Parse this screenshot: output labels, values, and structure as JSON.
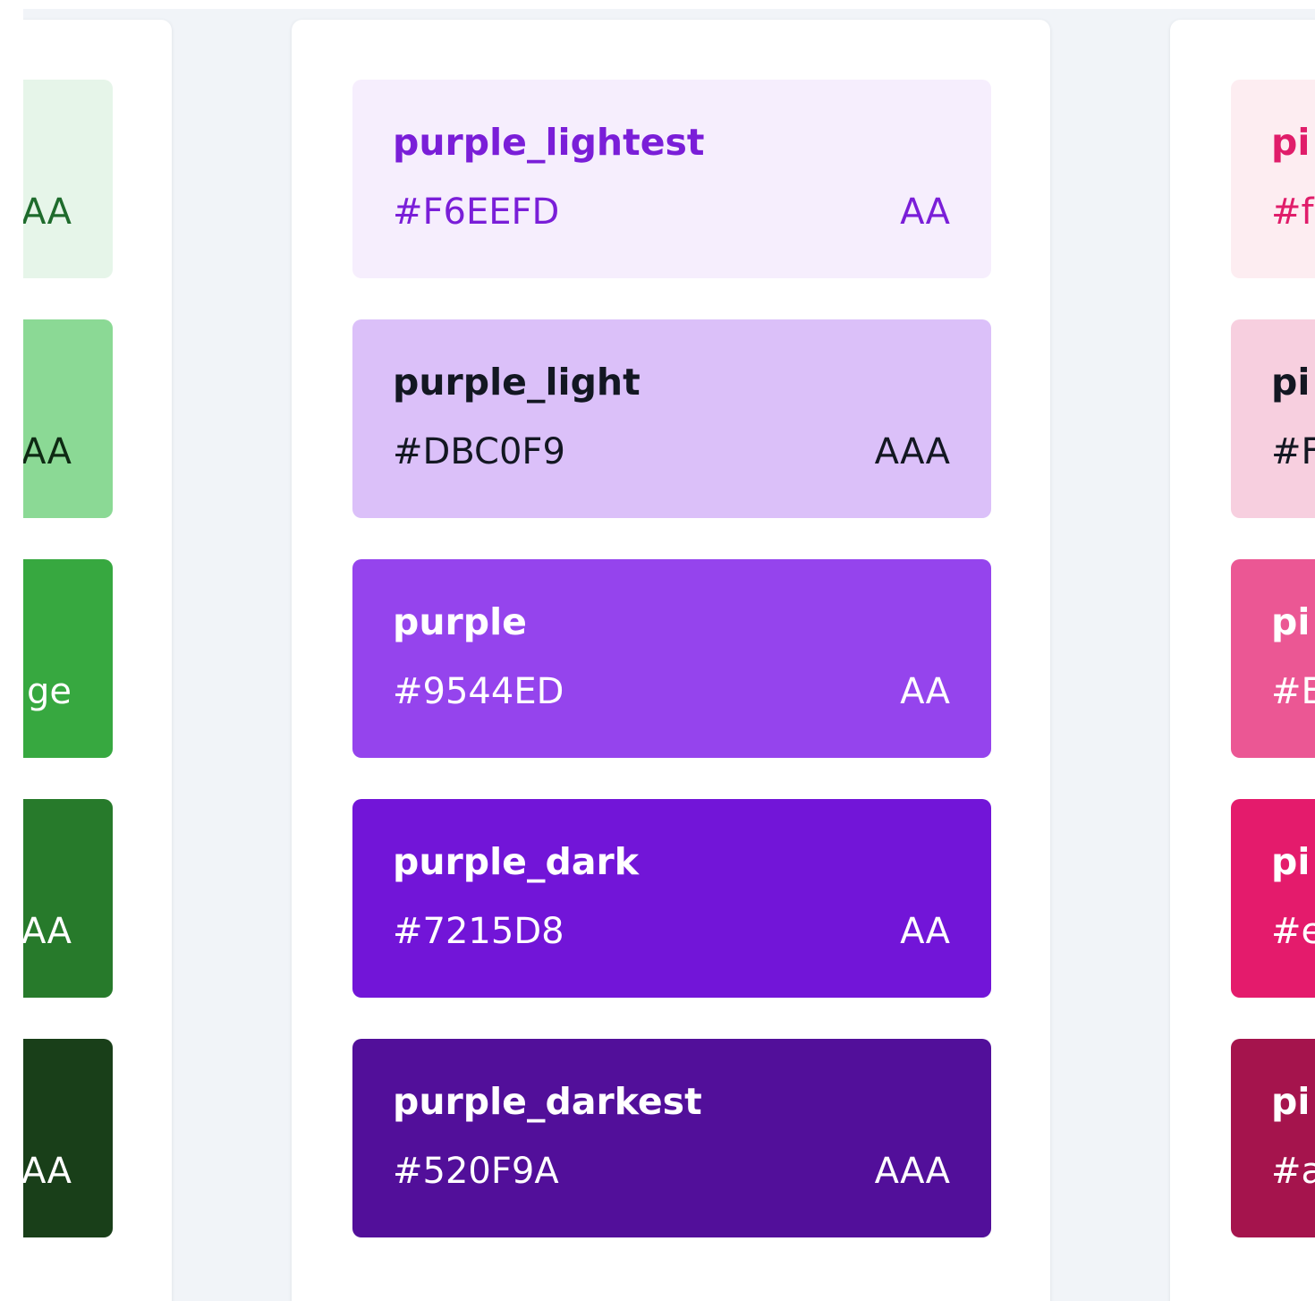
{
  "green_column": {
    "swatches": [
      {
        "hex": "",
        "grade": "AA",
        "bg": "#e6f5e9",
        "fg": "#1e6b2c"
      },
      {
        "hex": "",
        "grade": "AA",
        "bg": "#8bd995",
        "fg": "#0e2a13"
      },
      {
        "hex": "",
        "grade": "ge",
        "bg": "#37a840",
        "fg": "#ffffff"
      },
      {
        "hex": "",
        "grade": "AA",
        "bg": "#277a2b",
        "fg": "#ffffff"
      },
      {
        "hex": "",
        "grade": "AA",
        "bg": "#193f19",
        "fg": "#ffffff"
      }
    ]
  },
  "purple_column": {
    "swatches": [
      {
        "name": "purple_lightest",
        "hex": "#F6EEFD",
        "grade": "AA",
        "bg": "#f6eefd",
        "fg": "#7a1ed8"
      },
      {
        "name": "purple_light",
        "hex": "#DBC0F9",
        "grade": "AAA",
        "bg": "#dbc0f9",
        "fg": "#131722"
      },
      {
        "name": "purple",
        "hex": "#9544ED",
        "grade": "AA",
        "bg": "#9544ed",
        "fg": "#ffffff"
      },
      {
        "name": "purple_dark",
        "hex": "#7215D8",
        "grade": "AA",
        "bg": "#7215d8",
        "fg": "#ffffff"
      },
      {
        "name": "purple_darkest",
        "hex": "#520F9A",
        "grade": "AAA",
        "bg": "#520f9a",
        "fg": "#ffffff"
      }
    ]
  },
  "pink_column": {
    "swatches": [
      {
        "name": "pi",
        "hex": "#f",
        "bg": "#fdedf1",
        "fg": "#e01d6a"
      },
      {
        "name": "pi",
        "hex": "#F",
        "bg": "#f7cfdf",
        "fg": "#131722"
      },
      {
        "name": "pi",
        "hex": "#E",
        "bg": "#eb5794",
        "fg": "#ffffff"
      },
      {
        "name": "pi",
        "hex": "#e",
        "bg": "#e41b6c",
        "fg": "#ffffff"
      },
      {
        "name": "pi",
        "hex": "#a",
        "bg": "#a5144d",
        "fg": "#ffffff"
      }
    ]
  }
}
